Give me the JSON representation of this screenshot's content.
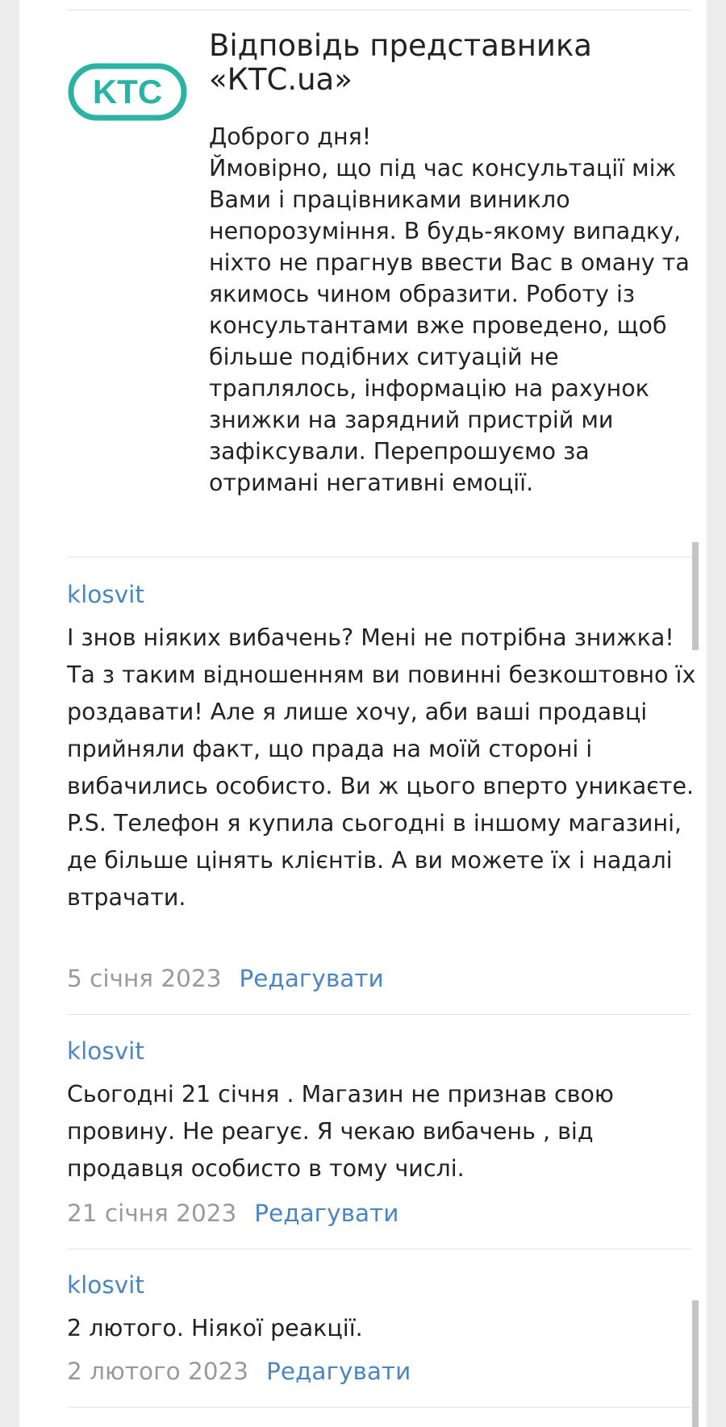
{
  "response": {
    "logo_text": "KTC",
    "title": "Відповідь представника «КТС.ua»",
    "body": "Доброго дня!\nЙмовірно, що під час консультації між Вами і працівниками виникло непорозуміння. В будь-якому випадку, ніхто не прагнув ввести Вас в оману та якимось чином образити. Роботу із консультантами вже проведено, щоб більше подібних ситуацій не траплялось, інформацію на рахунок знижки на зарядний пристрій ми зафіксували. Перепрошуємо за отримані негативні емоції."
  },
  "comments": [
    {
      "author": "klosvit",
      "text": "І знов ніяких вибачень? Мені не потрібна знижка! Та з таким відношенням ви повинні безкоштовно їх роздавати! Але я лише хочу, аби ваші продавці прийняли факт, що прада на моїй стороні і вибачились особисто. Ви ж цього вперто уникаєте.\nP.S. Телефон я купила сьогодні в іншому магазині, де більше цінять клієнтів. А ви можете їх і надалі втрачати.",
      "date": "5 січня 2023",
      "edit_label": "Редагувати"
    },
    {
      "author": "klosvit",
      "text": "Сьогодні 21 січня . Магазин не признав свою провину. Не реагує. Я чекаю вибачень , від продавця особисто в тому числі.",
      "date": "21 січня 2023",
      "edit_label": "Редагувати"
    },
    {
      "author": "klosvit",
      "text": "2 лютого. Ніякої реакції.",
      "date": "2 лютого 2023",
      "edit_label": "Редагувати"
    }
  ],
  "colors": {
    "brand_teal": "#2ab3a3",
    "link_blue": "#4a86c6",
    "date_gray": "#9a9a9a"
  }
}
